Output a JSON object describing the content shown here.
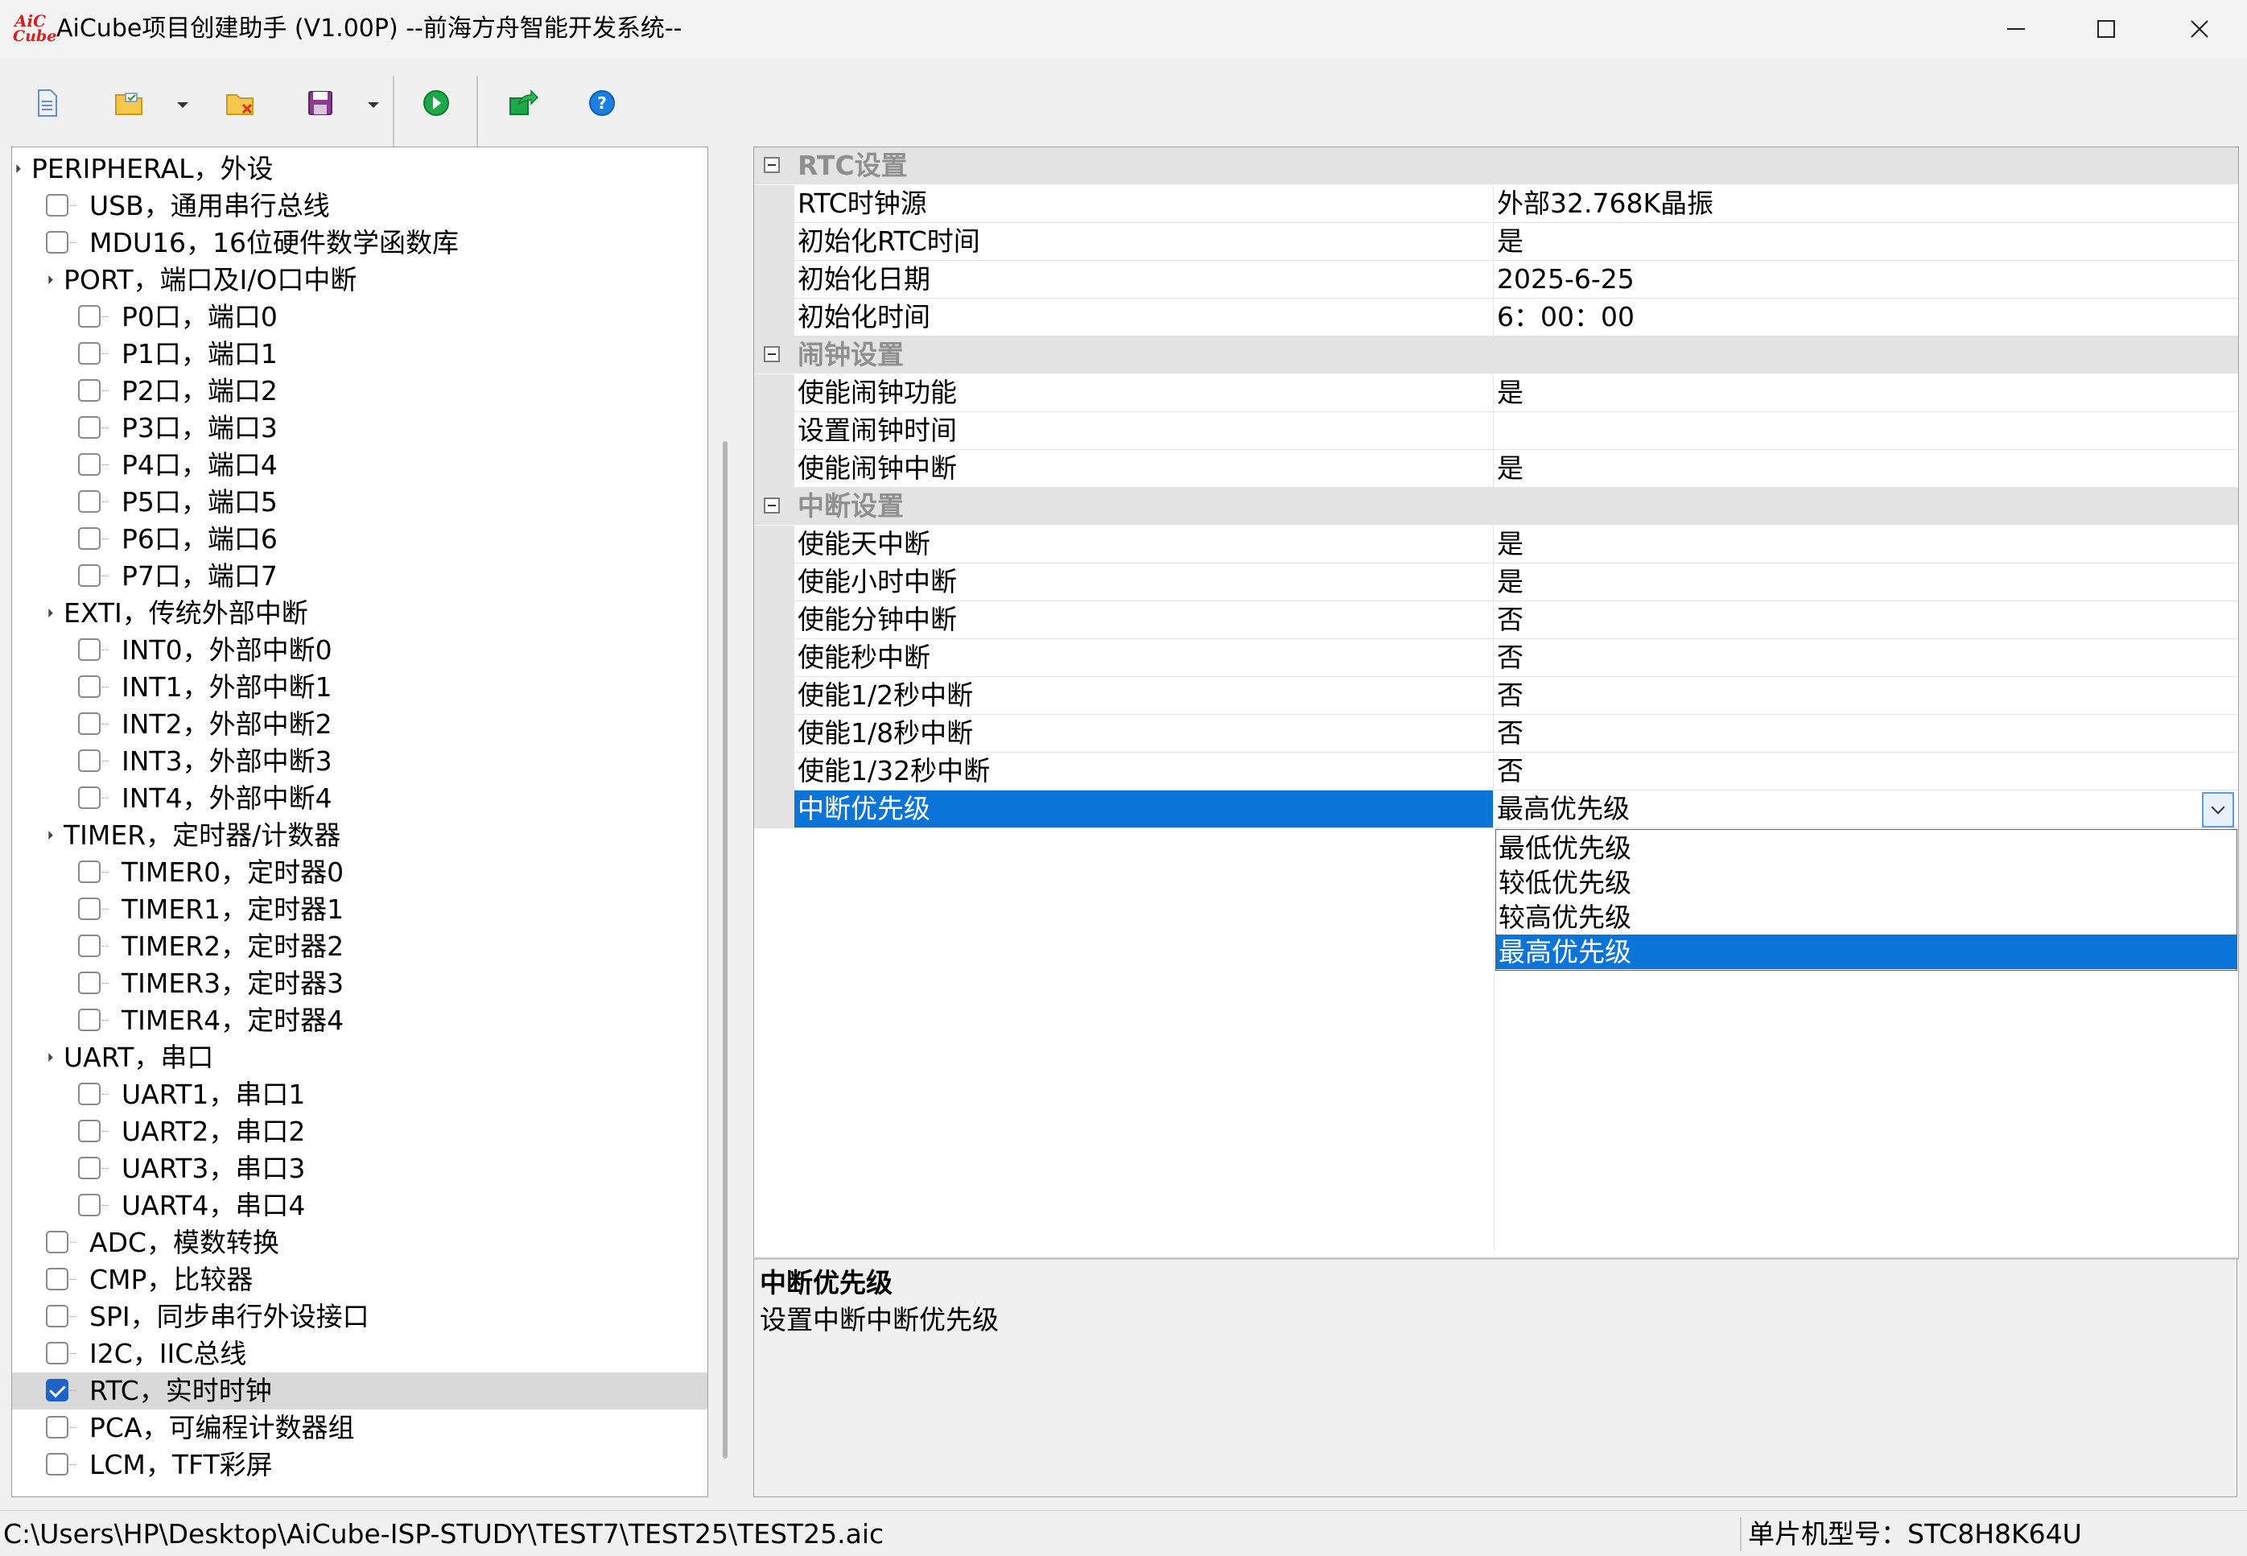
{
  "window": {
    "logo_text": [
      "AiC",
      "Cube"
    ],
    "title": "AiCube项目创建助手 (V1.00P) --前海方舟智能开发系统--"
  },
  "toolbar": {
    "buttons": [
      {
        "icon": "new-file-icon"
      },
      {
        "icon": "open-folder-icon"
      },
      {
        "icon": "close-project-icon"
      },
      {
        "icon": "save-icon"
      },
      {
        "icon": "run-icon"
      },
      {
        "icon": "export-icon"
      },
      {
        "icon": "help-icon"
      }
    ]
  },
  "tree": {
    "root": "PERIPHERAL，外设",
    "items": [
      {
        "label": "USB，通用串行总线",
        "level": 1,
        "checked": false
      },
      {
        "label": "MDU16，16位硬件数学函数库",
        "level": 1,
        "checked": false
      },
      {
        "label": "PORT，端口及I/O口中断",
        "level": 1,
        "group": true
      },
      {
        "label": "P0口，端口0",
        "level": 2,
        "checked": false
      },
      {
        "label": "P1口，端口1",
        "level": 2,
        "checked": false
      },
      {
        "label": "P2口，端口2",
        "level": 2,
        "checked": false
      },
      {
        "label": "P3口，端口3",
        "level": 2,
        "checked": false
      },
      {
        "label": "P4口，端口4",
        "level": 2,
        "checked": false
      },
      {
        "label": "P5口，端口5",
        "level": 2,
        "checked": false
      },
      {
        "label": "P6口，端口6",
        "level": 2,
        "checked": false
      },
      {
        "label": "P7口，端口7",
        "level": 2,
        "checked": false
      },
      {
        "label": "EXTI，传统外部中断",
        "level": 1,
        "group": true
      },
      {
        "label": "INT0，外部中断0",
        "level": 2,
        "checked": false
      },
      {
        "label": "INT1，外部中断1",
        "level": 2,
        "checked": false
      },
      {
        "label": "INT2，外部中断2",
        "level": 2,
        "checked": false
      },
      {
        "label": "INT3，外部中断3",
        "level": 2,
        "checked": false
      },
      {
        "label": "INT4，外部中断4",
        "level": 2,
        "checked": false
      },
      {
        "label": "TIMER，定时器/计数器",
        "level": 1,
        "group": true
      },
      {
        "label": "TIMER0，定时器0",
        "level": 2,
        "checked": false
      },
      {
        "label": "TIMER1，定时器1",
        "level": 2,
        "checked": false
      },
      {
        "label": "TIMER2，定时器2",
        "level": 2,
        "checked": false
      },
      {
        "label": "TIMER3，定时器3",
        "level": 2,
        "checked": false
      },
      {
        "label": "TIMER4，定时器4",
        "level": 2,
        "checked": false
      },
      {
        "label": "UART，串口",
        "level": 1,
        "group": true
      },
      {
        "label": "UART1，串口1",
        "level": 2,
        "checked": false
      },
      {
        "label": "UART2，串口2",
        "level": 2,
        "checked": false
      },
      {
        "label": "UART3，串口3",
        "level": 2,
        "checked": false
      },
      {
        "label": "UART4，串口4",
        "level": 2,
        "checked": false
      },
      {
        "label": "ADC，模数转换",
        "level": 1,
        "checked": false
      },
      {
        "label": "CMP，比较器",
        "level": 1,
        "checked": false
      },
      {
        "label": "SPI，同步串行外设接口",
        "level": 1,
        "checked": false
      },
      {
        "label": "I2C，IIC总线",
        "level": 1,
        "checked": false
      },
      {
        "label": "RTC，实时时钟",
        "level": 1,
        "checked": true,
        "selected": true
      },
      {
        "label": "PCA，可编程计数器组",
        "level": 1,
        "checked": false
      },
      {
        "label": "LCM，TFT彩屏",
        "level": 1,
        "checked": false
      }
    ]
  },
  "grid": {
    "rows": [
      {
        "category": "RTC设置"
      },
      {
        "name": "RTC时钟源",
        "value": "外部32.768K晶振"
      },
      {
        "name": "初始化RTC时间",
        "value": "是"
      },
      {
        "name": "初始化日期",
        "value": "2025-6-25"
      },
      {
        "name": "初始化时间",
        "value": "6：00：00"
      },
      {
        "category": "闹钟设置"
      },
      {
        "name": "使能闹钟功能",
        "value": "是"
      },
      {
        "name": "设置闹钟时间",
        "value": ""
      },
      {
        "name": "使能闹钟中断",
        "value": "是"
      },
      {
        "category": "中断设置"
      },
      {
        "name": "使能天中断",
        "value": "是"
      },
      {
        "name": "使能小时中断",
        "value": "是"
      },
      {
        "name": "使能分钟中断",
        "value": "否"
      },
      {
        "name": "使能秒中断",
        "value": "否"
      },
      {
        "name": "使能1/2秒中断",
        "value": "否"
      },
      {
        "name": "使能1/8秒中断",
        "value": "否"
      },
      {
        "name": "使能1/32秒中断",
        "value": "否"
      },
      {
        "name": "中断优先级",
        "value": "最高优先级",
        "selected": true,
        "dropdown": true
      }
    ],
    "dropdown_options": [
      "最低优先级",
      "较低优先级",
      "较高优先级",
      "最高优先级"
    ],
    "dropdown_selected": "最高优先级"
  },
  "description": {
    "title": "中断优先级",
    "text": "设置中断中断优先级"
  },
  "statusbar": {
    "path": "C:\\Users\\HP\\Desktop\\AiCube-ISP-STUDY\\TEST7\\TEST25\\TEST25.aic",
    "mcu": "单片机型号：STC8H8K64U"
  },
  "colors": {
    "selection": "#0a74d8",
    "category_bg": "#e3e3e3",
    "checkbox_checked": "#1e63c9",
    "logo": "#d42020"
  }
}
